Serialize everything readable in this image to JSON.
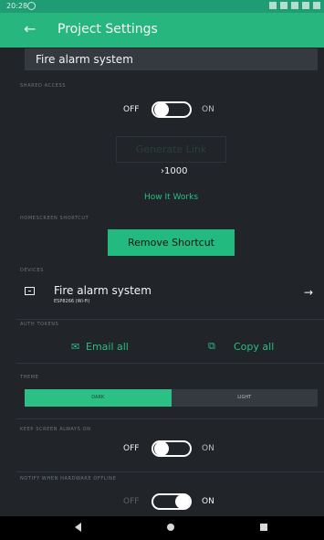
{
  "status_bar": {
    "time": "20:28"
  },
  "header": {
    "title": "Project Settings"
  },
  "project": {
    "name": "Fire alarm system"
  },
  "sections": {
    "shared_access": "SHARED ACCESS",
    "homescreen_shortcut": "HOMESCREEN SHORTCUT",
    "devices": "DEVICES",
    "auth_tokens": "AUTH TOKENS",
    "theme": "THEME",
    "keep_screen_always_on": "KEEP SCREEN ALWAYS ON",
    "notify_when_hardware_offline": "NOTIFY WHEN HARDWARE OFFLINE"
  },
  "shared_access": {
    "off_label": "OFF",
    "on_label": "ON",
    "enabled": false,
    "generate_link_label": "Generate Link",
    "energy_value": "1000",
    "how_it_works_label": "How It Works"
  },
  "homescreen": {
    "remove_shortcut_label": "Remove Shortcut"
  },
  "device": {
    "name": "Fire alarm system",
    "type": "ESP8266 (Wi-Fi)"
  },
  "auth": {
    "email_all_label": "Email all",
    "copy_all_label": "Copy all"
  },
  "theme": {
    "options": [
      "DARK",
      "LIGHT"
    ],
    "selected": "DARK"
  },
  "keep_screen_on": {
    "off_label": "OFF",
    "on_label": "ON",
    "enabled": false
  },
  "notify_offline": {
    "off_label": "OFF",
    "on_label": "ON",
    "enabled": true
  },
  "icons": {
    "back": "arrow-left-icon",
    "device": "device-icon",
    "forward": "arrow-right-icon",
    "email": "email-icon",
    "copy": "copy-icon"
  },
  "colors": {
    "accent": "#28b67f",
    "background": "#212529",
    "surface": "#343a40"
  }
}
